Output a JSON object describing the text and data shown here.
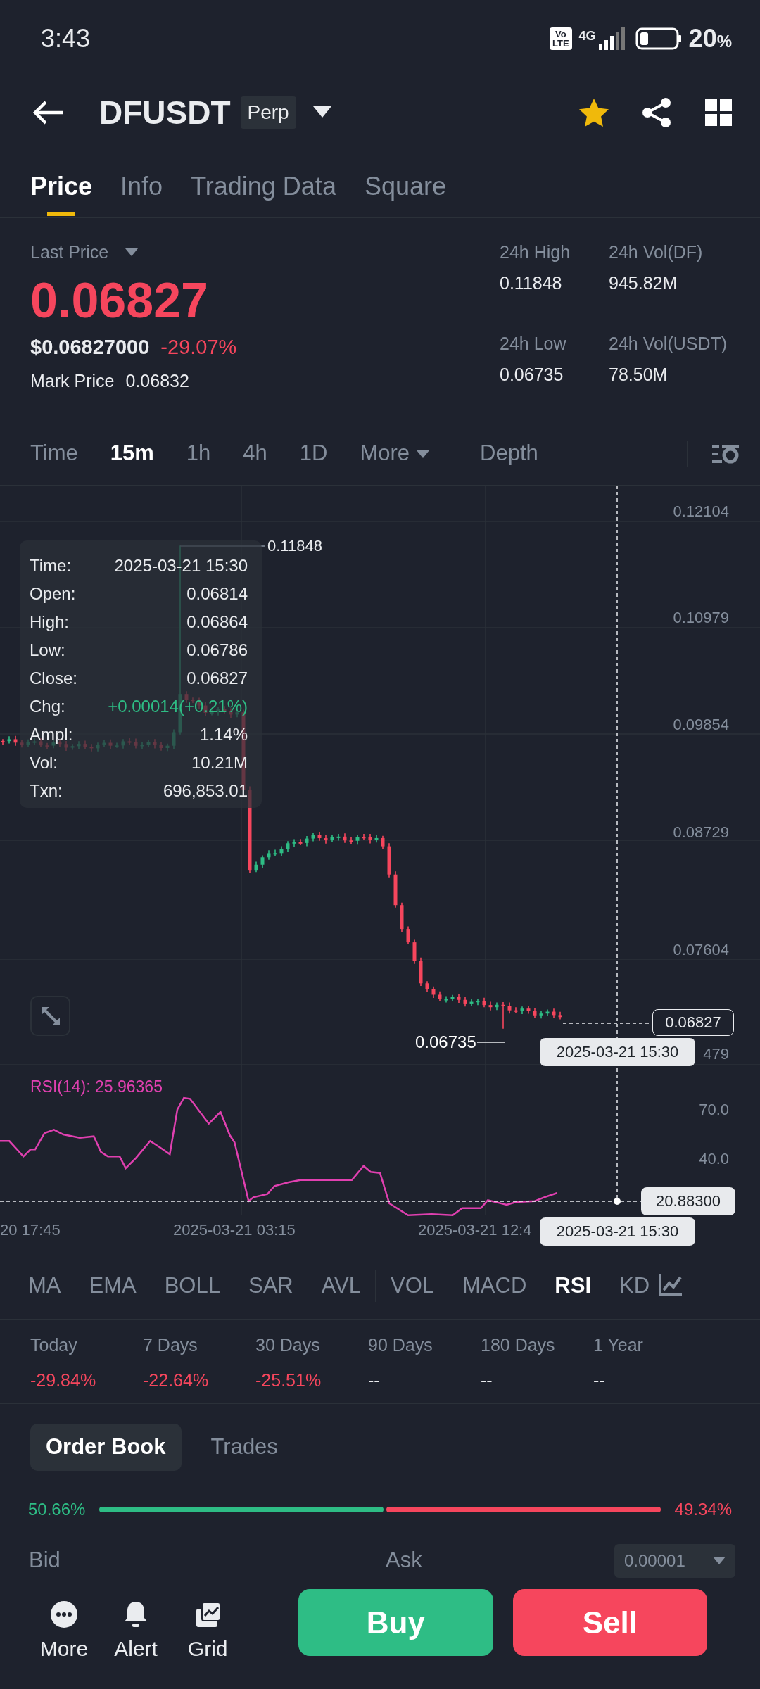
{
  "status_bar": {
    "time": "3:43",
    "volte": [
      "Vo",
      "LTE"
    ],
    "network": "4G",
    "battery_percent": "20",
    "battery_unit": "%"
  },
  "header": {
    "symbol": "DFUSDT",
    "contract_badge": "Perp",
    "favorite": true
  },
  "tabs": [
    {
      "label": "Price",
      "selected": true
    },
    {
      "label": "Info",
      "selected": false
    },
    {
      "label": "Trading Data",
      "selected": false
    },
    {
      "label": "Square",
      "selected": false
    }
  ],
  "stats": {
    "last_price_label": "Last Price",
    "last_price": "0.06827",
    "usd_price": "$0.06827000",
    "change": "-29.07%",
    "mark_price_label": "Mark Price",
    "mark_price": "0.06832",
    "items": [
      {
        "label": "24h High",
        "value": "0.11848"
      },
      {
        "label": "24h Vol(DF)",
        "value": "945.82M"
      },
      {
        "label": "24h Low",
        "value": "0.06735"
      },
      {
        "label": "24h Vol(USDT)",
        "value": "78.50M"
      }
    ]
  },
  "intervals": [
    {
      "label": "Time",
      "kind": "option",
      "selected": false
    },
    {
      "label": "15m",
      "kind": "option",
      "selected": true
    },
    {
      "label": "1h",
      "kind": "option",
      "selected": false
    },
    {
      "label": "4h",
      "kind": "option",
      "selected": false
    },
    {
      "label": "1D",
      "kind": "option",
      "selected": false
    },
    {
      "label": "More",
      "kind": "dropdown",
      "selected": false
    },
    {
      "label": "Depth",
      "kind": "option",
      "selected": false
    }
  ],
  "chart": {
    "price_ticks": [
      "0.12104",
      "0.10979",
      "0.09854",
      "0.08729",
      "0.07604",
      "479"
    ],
    "high_label": "0.11848",
    "low_label": "0.06735",
    "current_price": "0.06827",
    "crosshair_time": "2025-03-21 15:30",
    "rsi_label": "RSI(14): 25.96365",
    "rsi_ticks": [
      "70.0",
      "40.0"
    ],
    "rsi_crosshair_value": "20.88300",
    "rsi_crosshair_time": "2025-03-21 15:30",
    "time_ticks": [
      "20 17:45",
      "2025-03-21 03:15",
      "2025-03-21 12:4"
    ],
    "tooltip": [
      {
        "label": "Time:",
        "value": "2025-03-21 15:30",
        "color": "#eaecef"
      },
      {
        "label": "Open:",
        "value": "0.06814",
        "color": "#eaecef"
      },
      {
        "label": "High:",
        "value": "0.06864",
        "color": "#eaecef"
      },
      {
        "label": "Low:",
        "value": "0.06786",
        "color": "#eaecef"
      },
      {
        "label": "Close:",
        "value": "0.06827",
        "color": "#eaecef"
      },
      {
        "label": "Chg:",
        "value": "+0.00014(+0.21%)",
        "color": "#2ebd85"
      },
      {
        "label": "Ampl:",
        "value": "1.14%",
        "color": "#eaecef"
      },
      {
        "label": "Vol:",
        "value": "10.21M",
        "color": "#eaecef"
      },
      {
        "label": "Txn:",
        "value": "696,853.01",
        "color": "#eaecef"
      }
    ]
  },
  "indicators": [
    {
      "label": "MA",
      "divider_before": false,
      "selected": false
    },
    {
      "label": "EMA",
      "divider_before": false,
      "selected": false
    },
    {
      "label": "BOLL",
      "divider_before": false,
      "selected": false
    },
    {
      "label": "SAR",
      "divider_before": false,
      "selected": false
    },
    {
      "label": "AVL",
      "divider_before": false,
      "selected": false
    },
    {
      "label": "VOL",
      "divider_before": true,
      "selected": false
    },
    {
      "label": "MACD",
      "divider_before": false,
      "selected": false
    },
    {
      "label": "RSI",
      "divider_before": false,
      "selected": true
    },
    {
      "label": "KD",
      "divider_before": false,
      "selected": false
    }
  ],
  "performance": [
    {
      "label": "Today",
      "value": "-29.84%",
      "color": "#f6465d"
    },
    {
      "label": "7 Days",
      "value": "-22.64%",
      "color": "#f6465d"
    },
    {
      "label": "30 Days",
      "value": "-25.51%",
      "color": "#f6465d"
    },
    {
      "label": "90 Days",
      "value": "--",
      "color": "#eaecef"
    },
    {
      "label": "180 Days",
      "value": "--",
      "color": "#eaecef"
    },
    {
      "label": "1 Year",
      "value": "--",
      "color": "#eaecef"
    }
  ],
  "order_book": {
    "tabs": [
      {
        "label": "Order Book",
        "selected": true
      },
      {
        "label": "Trades",
        "selected": false
      }
    ],
    "bid_percent": "50.66%",
    "ask_percent": "49.34%",
    "level": 0.5066,
    "bid_label": "Bid",
    "ask_label": "Ask",
    "precision": "0.00001"
  },
  "bottom_bar": {
    "actions": [
      {
        "label": "More",
        "kind": "more"
      },
      {
        "label": "Alert",
        "kind": "alert"
      },
      {
        "label": "Grid",
        "kind": "grid"
      }
    ],
    "buy": "Buy",
    "sell": "Sell"
  }
}
